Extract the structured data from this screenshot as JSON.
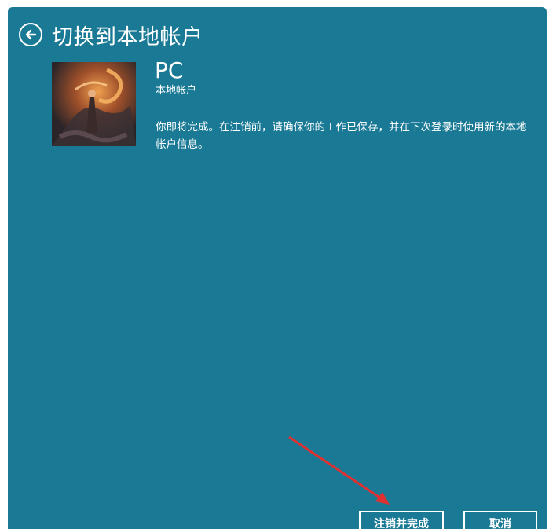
{
  "header": {
    "title": "切换到本地帐户",
    "back_icon": "back-arrow-circle-icon"
  },
  "account": {
    "name": "PC",
    "type": "本地帐户",
    "avatar": "avatar-image"
  },
  "message": "你即将完成。在注销前，请确保你的工作已保存，并在下次登录时使用新的本地帐户信息。",
  "buttons": {
    "sign_out_finish": "注销并完成",
    "cancel": "取消"
  },
  "colors": {
    "background": "#1a7a95",
    "text": "#ffffff",
    "annotation_arrow": "#e03030"
  }
}
